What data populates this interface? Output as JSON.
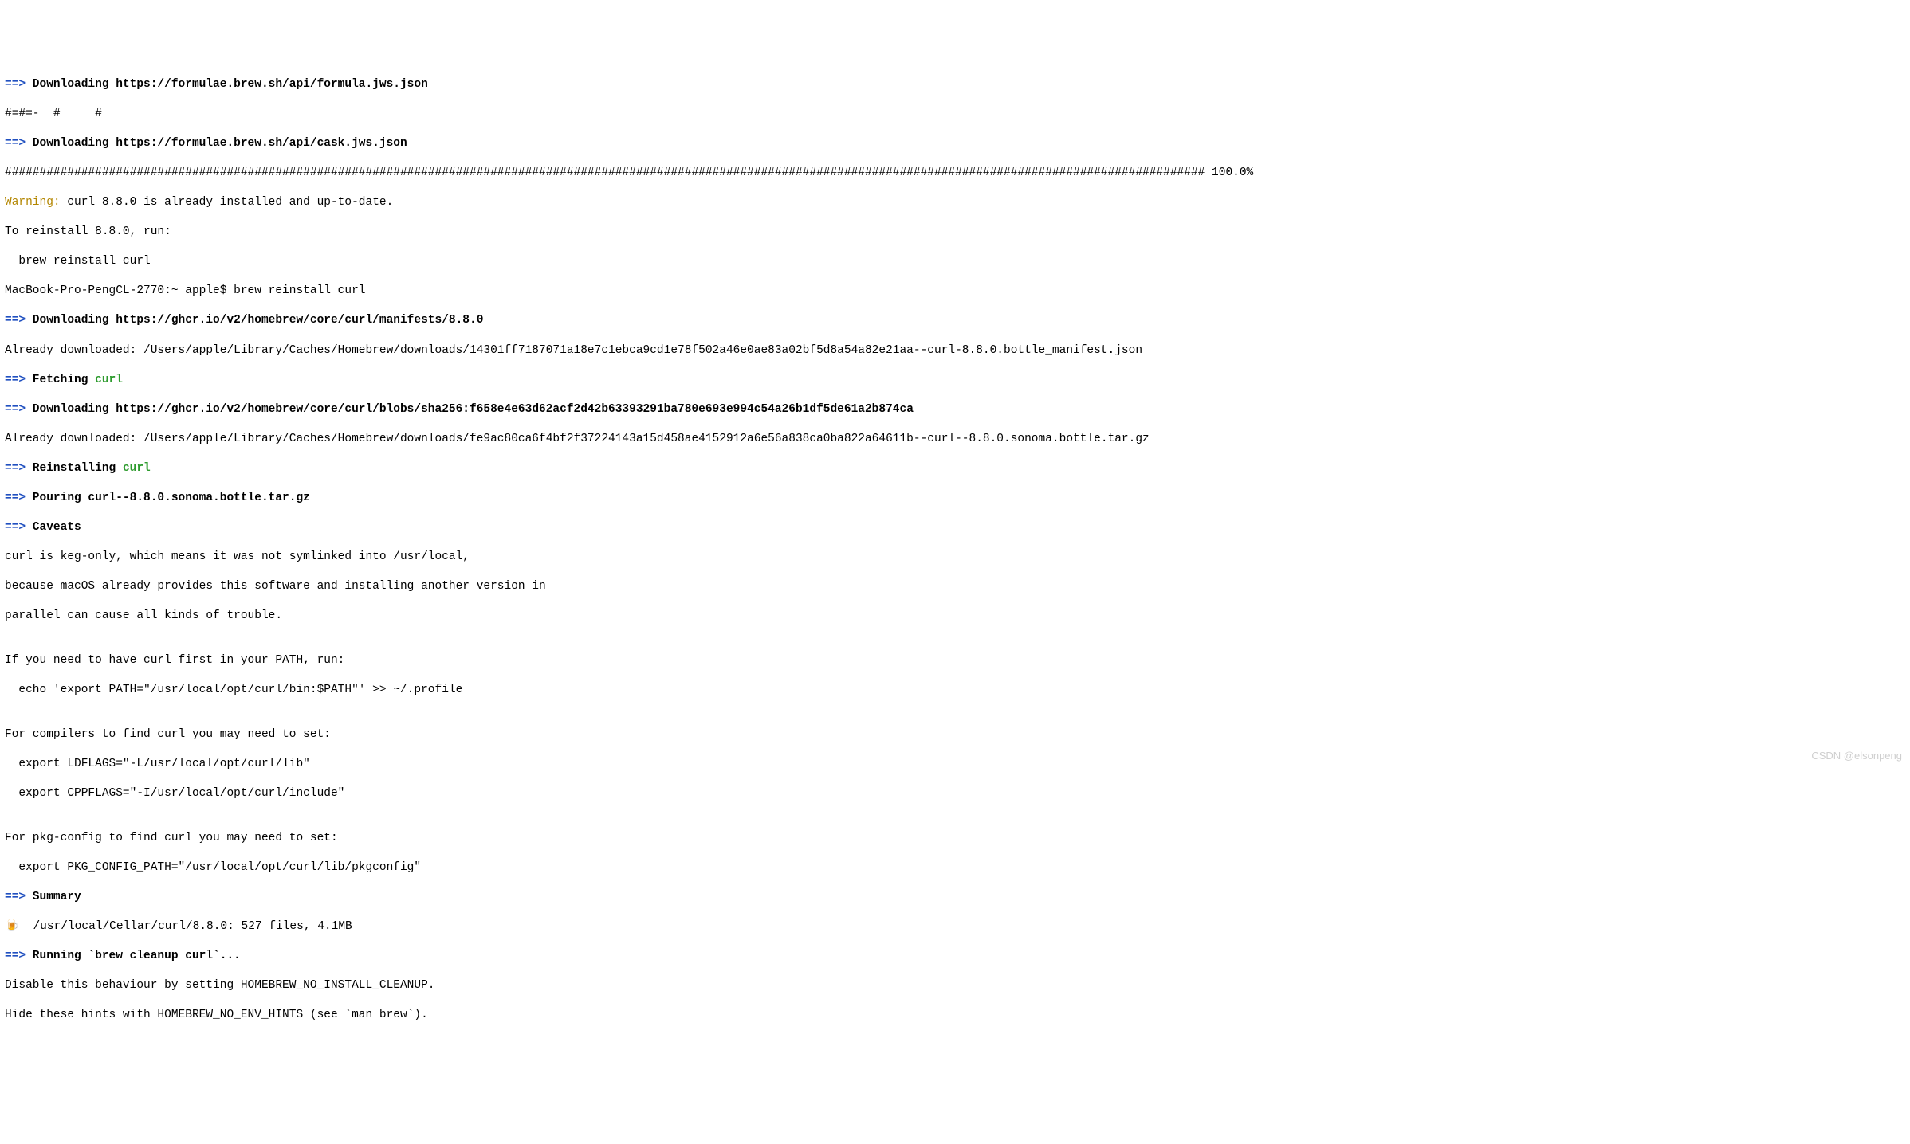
{
  "lines": {
    "l1_arrow": "==>",
    "l1_text": " Downloading https://formulae.brew.sh/api/formula.jws.json",
    "l2": "#=#=-  #     #",
    "l3_arrow": "==>",
    "l3_text": " Downloading https://formulae.brew.sh/api/cask.jws.json",
    "l4": "############################################################################################################################################################################# 100.0%",
    "l5_warn": "Warning:",
    "l5_text": " curl 8.8.0 is already installed and up-to-date.",
    "l6": "To reinstall 8.8.0, run:",
    "l7": "  brew reinstall curl",
    "l8": "MacBook-Pro-PengCL-2770:~ apple$ brew reinstall curl",
    "l9_arrow": "==>",
    "l9_text": " Downloading https://ghcr.io/v2/homebrew/core/curl/manifests/8.8.0",
    "l10": "Already downloaded: /Users/apple/Library/Caches/Homebrew/downloads/14301ff7187071a18e7c1ebca9cd1e78f502a46e0ae83a02bf5d8a54a82e21aa--curl-8.8.0.bottle_manifest.json",
    "l11_arrow": "==>",
    "l11_text": " Fetching ",
    "l11_pkg": "curl",
    "l12_arrow": "==>",
    "l12_text": " Downloading https://ghcr.io/v2/homebrew/core/curl/blobs/sha256:f658e4e63d62acf2d42b63393291ba780e693e994c54a26b1df5de61a2b874ca",
    "l13": "Already downloaded: /Users/apple/Library/Caches/Homebrew/downloads/fe9ac80ca6f4bf2f37224143a15d458ae4152912a6e56a838ca0ba822a64611b--curl--8.8.0.sonoma.bottle.tar.gz",
    "l14_arrow": "==>",
    "l14_text": " Reinstalling ",
    "l14_pkg": "curl",
    "l15_arrow": "==>",
    "l15_text": " Pouring curl--8.8.0.sonoma.bottle.tar.gz",
    "l16_arrow": "==>",
    "l16_text": " Caveats",
    "l17": "curl is keg-only, which means it was not symlinked into /usr/local,",
    "l18": "because macOS already provides this software and installing another version in",
    "l19": "parallel can cause all kinds of trouble.",
    "l20": "",
    "l21": "If you need to have curl first in your PATH, run:",
    "l22": "  echo 'export PATH=\"/usr/local/opt/curl/bin:$PATH\"' >> ~/.profile",
    "l23": "",
    "l24": "For compilers to find curl you may need to set:",
    "l25": "  export LDFLAGS=\"-L/usr/local/opt/curl/lib\"",
    "l26": "  export CPPFLAGS=\"-I/usr/local/opt/curl/include\"",
    "l27": "",
    "l28": "For pkg-config to find curl you may need to set:",
    "l29": "  export PKG_CONFIG_PATH=\"/usr/local/opt/curl/lib/pkgconfig\"",
    "l30_arrow": "==>",
    "l30_text": " Summary",
    "l31_icon": "🍺",
    "l31_text": "  /usr/local/Cellar/curl/8.8.0: 527 files, 4.1MB",
    "l32_arrow": "==>",
    "l32_text": " Running `brew cleanup curl`...",
    "l33": "Disable this behaviour by setting HOMEBREW_NO_INSTALL_CLEANUP.",
    "l34": "Hide these hints with HOMEBREW_NO_ENV_HINTS (see `man brew`)."
  },
  "watermark": "CSDN @elsonpeng"
}
